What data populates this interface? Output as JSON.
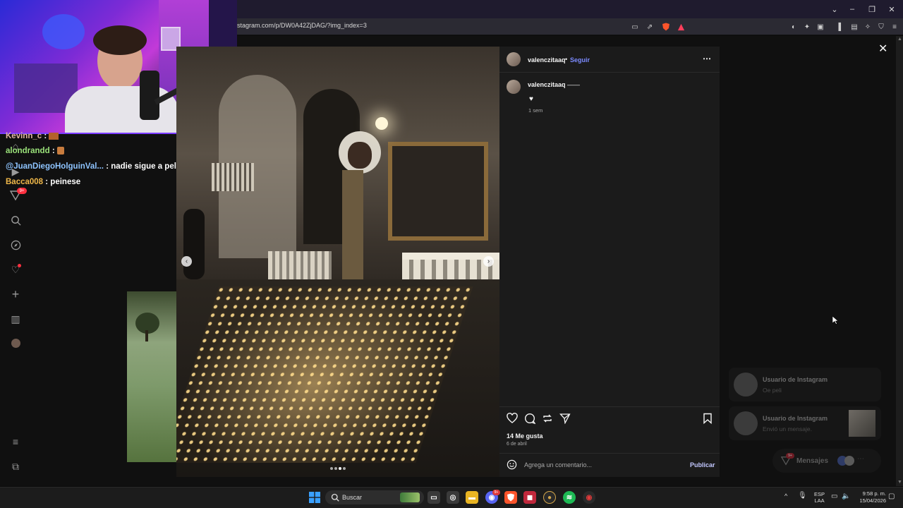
{
  "browser": {
    "url": "stagram.com/p/DW0A42ZjDAG/?img_index=3"
  },
  "chat": {
    "lines": [
      {
        "user": "Kevinn_c",
        "sep": " :",
        "message": "",
        "color": "#e0b5a0"
      },
      {
        "user": "alondrandd",
        "sep": " :",
        "message": "",
        "color": "#9be37a"
      },
      {
        "user": "@JuanDiegoHolguinVal...",
        "sep": " :",
        "message": " nadie sigue a peli",
        "color": "#8ec4ff"
      },
      {
        "user": "Bacca008",
        "sep": " :",
        "message": " peinese",
        "color": "#f0b84a"
      }
    ]
  },
  "post": {
    "author": "valenczitaaq",
    "follow_label": "Seguir",
    "more_icon": "ellipsis-icon",
    "caption_author": "valenczitaaq",
    "caption_suffix": "——",
    "caption_text": "♥",
    "caption_time": "1 sem",
    "likes": "14 Me gusta",
    "date": "6 de abril",
    "comment_placeholder": "Agrega un comentario...",
    "publish_label": "Publicar"
  },
  "messages": {
    "items": [
      {
        "name": "Usuario de Instagram",
        "preview": "Oe peli"
      },
      {
        "name": "Usuario de Instagram",
        "preview": "Envió un mensaje."
      }
    ],
    "button_label": "Mensajes",
    "badge": "9+"
  },
  "sidebar": {
    "badge": "9+",
    "icons": [
      "home-icon",
      "reels-icon",
      "messenger-icon",
      "search-icon",
      "explore-icon",
      "heart-icon",
      "create-icon",
      "dashboard-icon",
      "profile-icon",
      "menu-icon",
      "meta-icon"
    ]
  },
  "taskbar": {
    "search_label": "Buscar",
    "lang_top": "ESP",
    "lang_bottom": "LAA",
    "time": "9:58 p. m.",
    "date": "15/04/2026",
    "discord_badge": "9+"
  },
  "colors": {
    "accent_blue": "#7c8bff",
    "ig_panel": "#1b1b1b"
  }
}
